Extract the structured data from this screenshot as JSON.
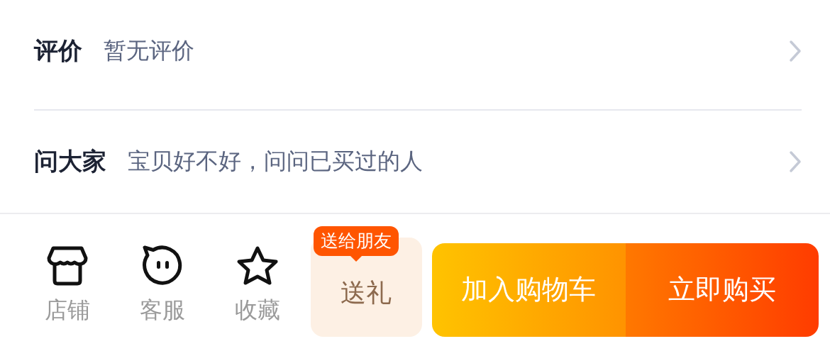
{
  "rows": [
    {
      "title": "评价",
      "subtitle": "暂无评价"
    },
    {
      "title": "问大家",
      "subtitle": "宝贝好不好，问问已买过的人"
    }
  ],
  "actions": [
    {
      "kind": "shop",
      "label": "店铺"
    },
    {
      "kind": "service",
      "label": "客服"
    },
    {
      "kind": "favorite",
      "label": "收藏"
    }
  ],
  "gift": {
    "badge": "送给朋友",
    "label": "送礼"
  },
  "buttons": [
    {
      "kind": "cart",
      "label": "加入购物车"
    },
    {
      "kind": "buy",
      "label": "立即购买"
    }
  ]
}
